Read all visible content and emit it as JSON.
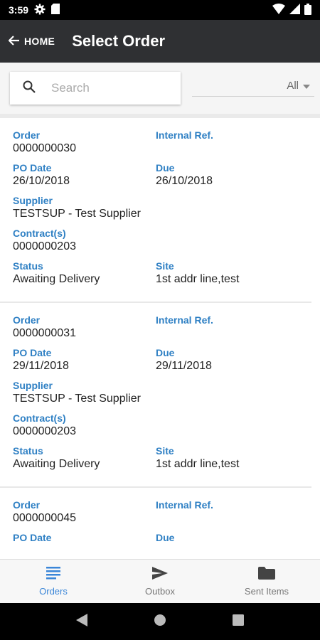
{
  "status_bar": {
    "time": "3:59"
  },
  "app_bar": {
    "back_label": "HOME",
    "title": "Select Order"
  },
  "search": {
    "placeholder": "Search",
    "value": ""
  },
  "filter": {
    "value": "All"
  },
  "labels": {
    "order": "Order",
    "internal_ref": "Internal Ref.",
    "po_date": "PO Date",
    "due": "Due",
    "supplier": "Supplier",
    "contracts": "Contract(s)",
    "status": "Status",
    "site": "Site"
  },
  "orders": [
    {
      "order": "0000000030",
      "internal_ref": "",
      "po_date": "26/10/2018",
      "due": "26/10/2018",
      "supplier": "TESTSUP - Test Supplier",
      "contracts": "0000000203",
      "status": "Awaiting Delivery",
      "site": "1st addr line,test"
    },
    {
      "order": "0000000031",
      "internal_ref": "",
      "po_date": "29/11/2018",
      "due": "29/11/2018",
      "supplier": "TESTSUP - Test Supplier",
      "contracts": "0000000203",
      "status": "Awaiting Delivery",
      "site": "1st addr line,test"
    },
    {
      "order": "0000000045",
      "internal_ref": "",
      "po_date": "",
      "due": "",
      "supplier": "",
      "contracts": "",
      "status": "",
      "site": ""
    }
  ],
  "bottom_nav": [
    {
      "label": "Orders",
      "icon": "list-icon",
      "active": true
    },
    {
      "label": "Outbox",
      "icon": "send-icon",
      "active": false
    },
    {
      "label": "Sent Items",
      "icon": "folder-icon",
      "active": false
    }
  ],
  "colors": {
    "accent": "#3a86d8",
    "label_blue": "#2f80c4",
    "app_bar": "#2f3033"
  }
}
